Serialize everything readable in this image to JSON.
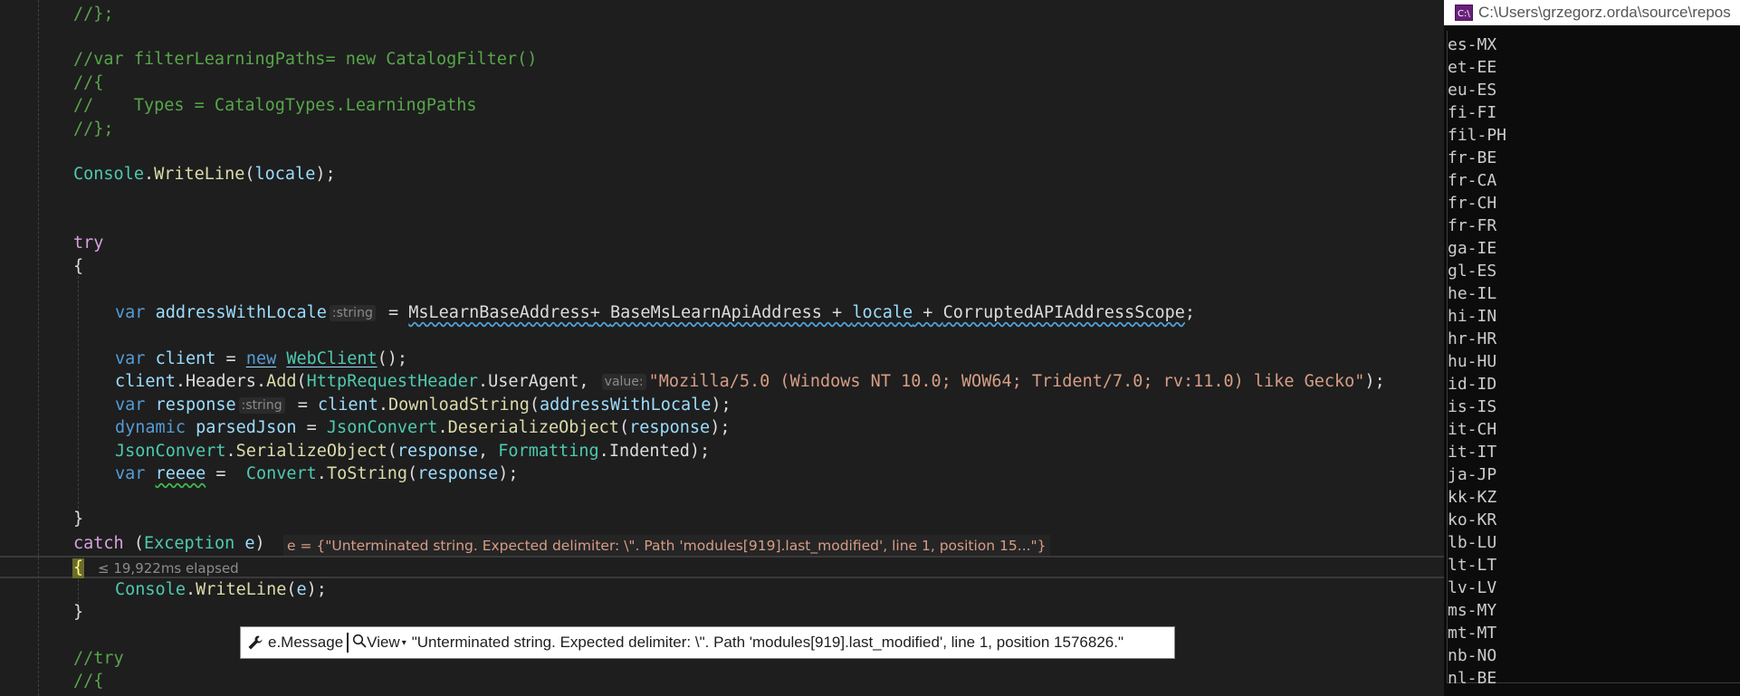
{
  "editor": {
    "lines": {
      "l1": "//};",
      "l2": "//var filterLearningPaths= new CatalogFilter()",
      "l3": "//{",
      "l4": "//    Types = CatalogTypes.LearningPaths",
      "l5": "//};",
      "try_kw": "try",
      "open_brace": "{",
      "close_brace": "}",
      "catch_kw": "catch",
      "var_kw": "var",
      "new_kw": "new",
      "dynamic_kw": "dynamic",
      "exception_type": "Exception",
      "console_cls": "Console",
      "writeline": "WriteLine",
      "locale": "locale",
      "address_with_locale": "addressWithLocale",
      "ms_learn_base": "MsLearnBaseAddress",
      "base_api": "BaseMsLearnApiAddress",
      "corrupted_scope": "CorruptedAPIAddressScope",
      "client": "client",
      "webclient": "WebClient",
      "headers": "Headers",
      "add": "Add",
      "http_header": "HttpRequestHeader",
      "user_agent": "UserAgent",
      "user_agent_value": "\"Mozilla/5.0 (Windows NT 10.0; WOW64; Trident/7.0; rv:11.0) like Gecko\"",
      "response": "response",
      "download_string": "DownloadString",
      "parsed_json": "parsedJson",
      "json_convert": "JsonConvert",
      "deserialize": "DeserializeObject",
      "serialize": "SerializeObject",
      "formatting": "Formatting",
      "indented": "Indented",
      "reeee": "reeee",
      "convert": "Convert",
      "to_string": "ToString",
      "e": "e",
      "try_comment": "//try",
      "brace_comment": "//{"
    },
    "inlay_hints": {
      "type_string": ":string",
      "value_label": "value:"
    },
    "debug": {
      "exception_inline": "e = {\"Unterminated string. Expected delimiter: \\\". Path 'modules[919].last_modified', line 1, position 15...\"}",
      "elapsed": "≤ 19,922ms elapsed"
    },
    "datatip": {
      "expression": "e.Message",
      "view_label": "View",
      "value": "\"Unterminated string. Expected delimiter: \\\". Path 'modules[919].last_modified', line 1, position 1576826.\""
    }
  },
  "console": {
    "title": "C:\\Users\\grzegorz.orda\\source\\repos",
    "icon": "console-app-icon",
    "lines": [
      "es-MX",
      "et-EE",
      "eu-ES",
      "fi-FI",
      "fil-PH",
      "fr-BE",
      "fr-CA",
      "fr-CH",
      "fr-FR",
      "ga-IE",
      "gl-ES",
      "he-IL",
      "hi-IN",
      "hr-HR",
      "hu-HU",
      "id-ID",
      "is-IS",
      "it-CH",
      "it-IT",
      "ja-JP",
      "kk-KZ",
      "ko-KR",
      "lb-LU",
      "lt-LT",
      "lv-LV",
      "ms-MY",
      "mt-MT",
      "nb-NO",
      "nl-BE"
    ]
  },
  "colors": {
    "editor_bg": "#1e1e1e",
    "comment": "#57a64a",
    "keyword": "#569cd6",
    "control_keyword": "#d8a0df",
    "type": "#4ec9b0",
    "method": "#dcdcaa",
    "variable": "#9cdcfe",
    "string": "#d69d85",
    "console_bg": "#0c0c0c"
  }
}
